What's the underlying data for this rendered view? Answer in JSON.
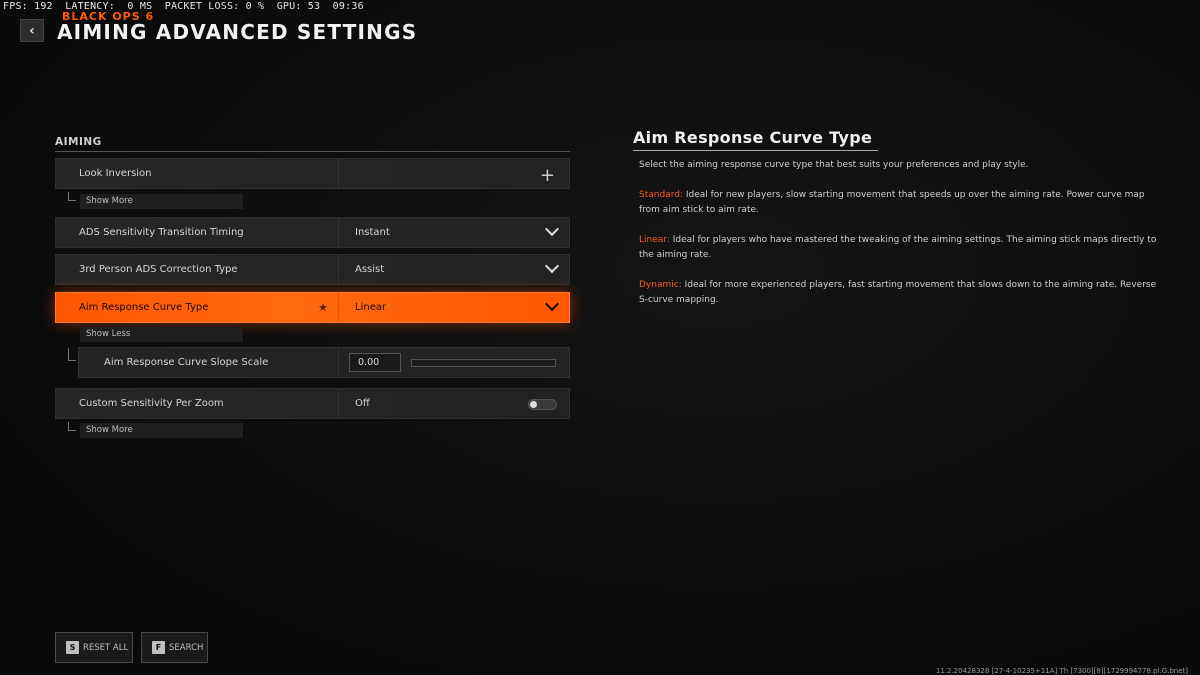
{
  "stats": "FPS: 192  LATENCY:  0 MS  PACKET LOSS: 0 %  GPU: 53  09:36",
  "header": {
    "logo": "BLACK OPS 6",
    "title": "AIMING ADVANCED SETTINGS",
    "back_icon": "chevron-left-icon"
  },
  "section": {
    "label": "AIMING"
  },
  "settings": [
    {
      "label": "Look Inversion",
      "value": "",
      "control": "plus-icon"
    },
    {
      "label": "ADS Sensitivity Transition Timing",
      "value": "Instant",
      "control": "chevron-down-icon"
    },
    {
      "label": "3rd Person ADS Correction Type",
      "value": "Assist",
      "control": "chevron-down-icon"
    },
    {
      "label": "Aim Response Curve Type",
      "value": "Linear",
      "control": "chevron-down-icon",
      "favorite": "★"
    },
    {
      "label": "Custom Sensitivity Per Zoom",
      "value": "Off",
      "control": "toggle"
    }
  ],
  "show_more_1": "Show More",
  "show_less": "Show Less",
  "show_more_2": "Show More",
  "subsetting": {
    "label": "Aim Response Curve Slope Scale",
    "value": "0.00",
    "slider_fraction": 0
  },
  "description": {
    "title": "Aim Response Curve Type",
    "intro": "Select the aiming response curve type that best suits your preferences and play style.",
    "standard_label": "Standard:",
    "standard_text": " Ideal for new players, slow starting movement that speeds up over the aiming rate. Power curve map from aim stick to aim rate.",
    "linear_label": "Linear:",
    "linear_text": "  Ideal for players who have mastered the tweaking of the aiming settings. The aiming stick maps directly to the aiming rate.",
    "dynamic_label": "Dynamic:",
    "dynamic_text": " Ideal for more experienced players, fast starting movement that slows down to the aiming rate. Reverse S-curve mapping."
  },
  "footer": {
    "reset_key": "S",
    "reset_label": "RESET ALL",
    "search_key": "F",
    "search_label": "SEARCH"
  },
  "build": "11.2.20428328 [27-4-10235+11A] Th [7300][8][1729994778.pl.G.bnet]",
  "colors": {
    "accent": "#ff5a00"
  }
}
